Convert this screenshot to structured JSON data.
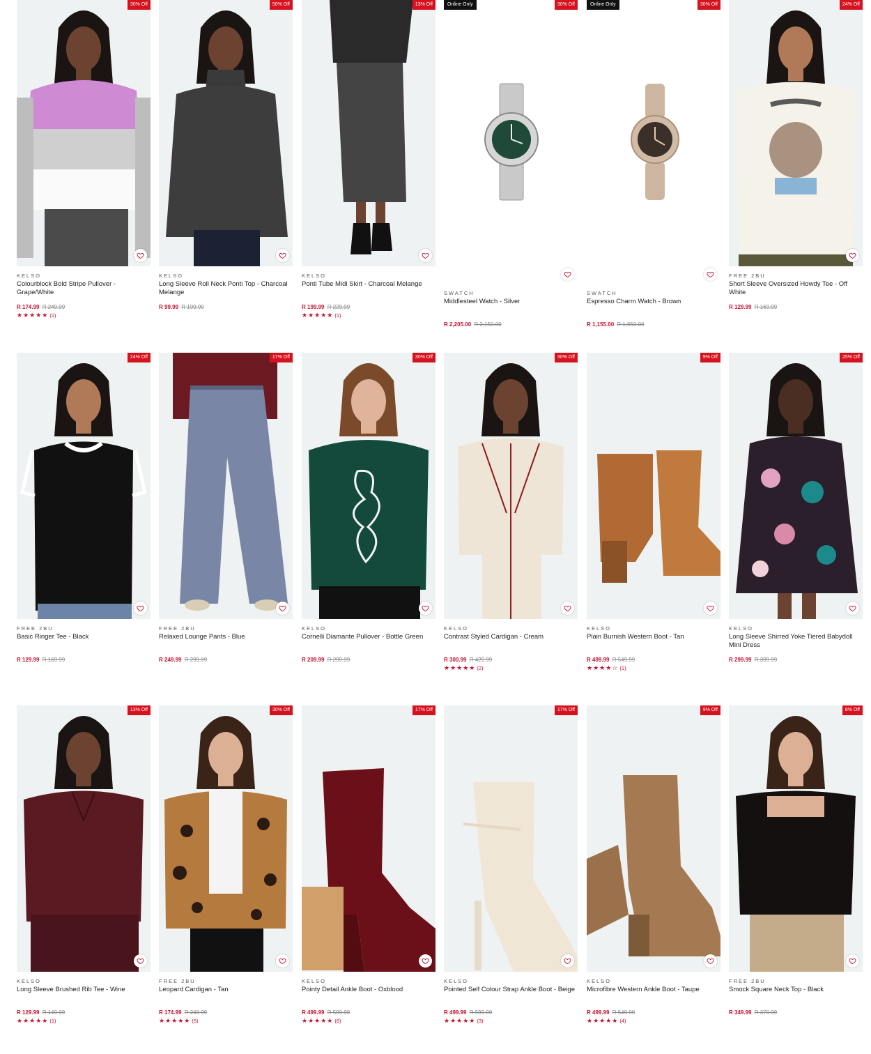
{
  "colors": {
    "accent": "#d6121f",
    "price": "#c8102e",
    "online_badge": "#111111",
    "image_bg": "#eef2f2"
  },
  "products": [
    {
      "brand": "KELSO",
      "name": "Colourblock Bold Stripe Pullover - Grape/White",
      "price": "R 174.99",
      "was": "R 249.99",
      "discount": "30% Off",
      "online": "",
      "stars": "★★★★★",
      "count": "(1)",
      "art": "pullover-stripe"
    },
    {
      "brand": "KELSO",
      "name": "Long Sleeve Roll Neck Ponti Top - Charcoal Melange",
      "price": "R 99.99",
      "was": "R 199.99",
      "discount": "50% Off",
      "online": "",
      "stars": "",
      "count": "",
      "art": "rollneck"
    },
    {
      "brand": "KELSO",
      "name": "Ponti Tube Midi Skirt - Charcoal Melange",
      "price": "R 199.99",
      "was": "R 229.99",
      "discount": "13% Off",
      "online": "",
      "stars": "★★★★★",
      "count": "(1)",
      "art": "skirt"
    },
    {
      "brand": "SWATCH",
      "name": "Middlesteel Watch - Silver",
      "price": "R 2,205.00",
      "was": "R 3,150.00",
      "discount": "30% Off",
      "online": "Online Only",
      "stars": "",
      "count": "",
      "art": "watch-silver"
    },
    {
      "brand": "SWATCH",
      "name": "Espresso Charm Watch - Brown",
      "price": "R 1,155.00",
      "was": "R 1,650.00",
      "discount": "30% Off",
      "online": "Online Only",
      "stars": "",
      "count": "",
      "art": "watch-brown"
    },
    {
      "brand": "FREE 2BU",
      "name": "Short Sleeve Oversized Howdy Tee - Off White",
      "price": "R 129.99",
      "was": "R 169.99",
      "discount": "24% Off",
      "online": "",
      "stars": "",
      "count": "",
      "art": "howdy-tee"
    },
    {
      "brand": "FREE 2BU",
      "name": "Basic Ringer Tee - Black",
      "price": "R 129.99",
      "was": "R 169.99",
      "discount": "24% Off",
      "online": "",
      "stars": "",
      "count": "",
      "art": "ringer-tee"
    },
    {
      "brand": "FREE 2BU",
      "name": "Relaxed Lounge Pants - Blue",
      "price": "R 249.99",
      "was": "R 299.99",
      "discount": "17% Off",
      "online": "",
      "stars": "",
      "count": "",
      "art": "lounge-pants"
    },
    {
      "brand": "KELSO",
      "name": "Cornelli Diamante Pullover - Bottle Green",
      "price": "R 209.99",
      "was": "R 299.99",
      "discount": "30% Off",
      "online": "",
      "stars": "",
      "count": "",
      "art": "green-pullover"
    },
    {
      "brand": "KELSO",
      "name": "Contrast Styled Cardigan - Cream",
      "price": "R 300.99",
      "was": "R 429.99",
      "discount": "30% Off",
      "online": "",
      "stars": "★★★★★",
      "count": "(2)",
      "art": "cream-cardigan"
    },
    {
      "brand": "KELSO",
      "name": "Plain Burnish Western Boot - Tan",
      "price": "R 499.99",
      "was": "R 549.99",
      "discount": "9% Off",
      "online": "",
      "stars": "★★★★☆",
      "count": "(1)",
      "art": "tan-boot"
    },
    {
      "brand": "KELSO",
      "name": "Long Sleeve Shirred Yoke Tiered Babydoll Mini Dress",
      "price": "R 299.99",
      "was": "R 399.99",
      "discount": "25% Off",
      "online": "",
      "stars": "",
      "count": "",
      "art": "floral-dress"
    },
    {
      "brand": "KELSO",
      "name": "Long Sleeve Brushed Rib Tee - Wine",
      "price": "R 129.99",
      "was": "R 149.99",
      "discount": "13% Off",
      "online": "",
      "stars": "★★★★★",
      "count": "(1)",
      "art": "wine-tee"
    },
    {
      "brand": "FREE 2BU",
      "name": "Leopard Cardigan - Tan",
      "price": "R 174.99",
      "was": "R 249.99",
      "discount": "30% Off",
      "online": "",
      "stars": "★★★★★",
      "count": "(5)",
      "art": "leopard-cardigan"
    },
    {
      "brand": "KELSO",
      "name": "Pointy Detail Ankle Boot - Oxblood",
      "price": "R 499.99",
      "was": "R 599.99",
      "discount": "17% Off",
      "online": "",
      "stars": "★★★★★",
      "count": "(6)",
      "art": "oxblood-boot"
    },
    {
      "brand": "KELSO",
      "name": "Pointed Self Colour Strap Ankle Boot - Beige",
      "price": "R 499.99",
      "was": "R 599.99",
      "discount": "17% Off",
      "online": "",
      "stars": "★★★★★",
      "count": "(3)",
      "art": "beige-boot"
    },
    {
      "brand": "KELSO",
      "name": "Microfibre Western Ankle Boot - Taupe",
      "price": "R 499.99",
      "was": "R 549.99",
      "discount": "9% Off",
      "online": "",
      "stars": "★★★★★",
      "count": "(4)",
      "art": "taupe-boot"
    },
    {
      "brand": "FREE 2BU",
      "name": "Smock Square Neck Top - Black",
      "price": "R 349.99",
      "was": "R 379.99",
      "discount": "8% Off",
      "online": "",
      "stars": "",
      "count": "",
      "art": "smock-top"
    }
  ]
}
